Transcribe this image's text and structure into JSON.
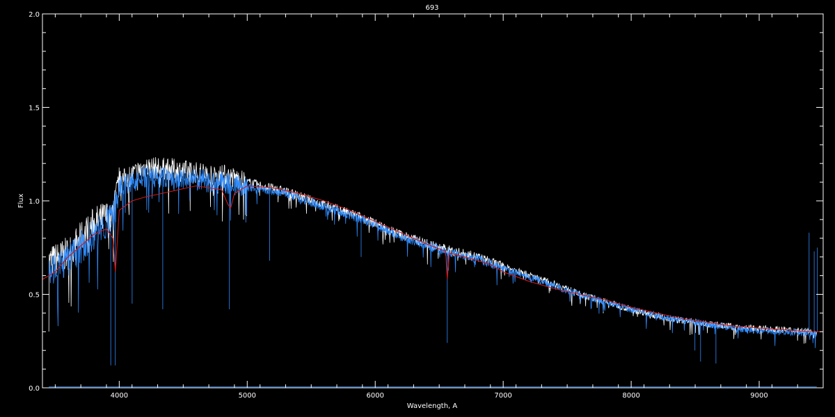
{
  "chart_data": {
    "type": "line",
    "title": "693",
    "xlabel": "Wavelength, A",
    "ylabel": "Flux",
    "xlim": [
      3400,
      9500
    ],
    "ylim": [
      0.0,
      2.0
    ],
    "x_ticks": [
      4000,
      5000,
      6000,
      7000,
      8000,
      9000
    ],
    "x_tick_labels": [
      "4000",
      "5000",
      "6000",
      "7000",
      "8000",
      "9000"
    ],
    "y_ticks": [
      0.0,
      0.5,
      1.0,
      1.5,
      2.0
    ],
    "y_tick_labels": [
      "0.0",
      "0.5",
      "1.0",
      "1.5",
      "2.0"
    ],
    "grid": false,
    "background": "#000000",
    "series": [
      {
        "color": "#ffffff",
        "style": "noisy-spectrum",
        "x": [
          3450,
          3600,
          3800,
          3950,
          4000,
          4200,
          4400,
          4600,
          4800,
          5000,
          5300,
          5600,
          5900,
          6200,
          6500,
          6800,
          7000,
          7300,
          7500,
          7600,
          7700,
          8000,
          8300,
          8600,
          8900,
          9200,
          9450
        ],
        "y": [
          0.67,
          0.72,
          0.88,
          0.93,
          1.1,
          1.18,
          1.17,
          1.15,
          1.14,
          1.1,
          1.05,
          0.98,
          0.91,
          0.82,
          0.75,
          0.7,
          0.65,
          0.58,
          0.53,
          0.5,
          0.48,
          0.42,
          0.37,
          0.34,
          0.32,
          0.31,
          0.3
        ]
      },
      {
        "color": "#2f8cff",
        "style": "noisy-spectrum",
        "x": [
          3450,
          3600,
          3800,
          3950,
          4000,
          4200,
          4400,
          4600,
          4800,
          5000,
          5300,
          5600,
          5900,
          6200,
          6500,
          6800,
          7000,
          7300,
          7500,
          7600,
          7700,
          8000,
          8300,
          8600,
          8900,
          9200,
          9450
        ],
        "y": [
          0.63,
          0.68,
          0.82,
          0.9,
          1.07,
          1.13,
          1.12,
          1.11,
          1.1,
          1.07,
          1.04,
          0.97,
          0.9,
          0.81,
          0.74,
          0.69,
          0.64,
          0.57,
          0.52,
          0.5,
          0.48,
          0.42,
          0.37,
          0.34,
          0.31,
          0.3,
          0.29
        ]
      },
      {
        "color": "#cc1a1a",
        "style": "smooth",
        "x": [
          3400,
          3500,
          3600,
          3700,
          3800,
          3900,
          3950,
          3970,
          4000,
          4100,
          4200,
          4400,
          4600,
          4800,
          4850,
          4870,
          4900,
          5000,
          5200,
          5400,
          5600,
          5800,
          6000,
          6200,
          6400,
          6550,
          6563,
          6580,
          6700,
          6900,
          7000,
          7200,
          7400,
          7600,
          7800,
          8000,
          8200,
          8400,
          8600,
          8800,
          9000,
          9200,
          9400,
          9500
        ],
        "y": [
          0.58,
          0.62,
          0.7,
          0.76,
          0.82,
          0.85,
          0.8,
          0.62,
          0.95,
          1.0,
          1.02,
          1.05,
          1.08,
          1.06,
          0.98,
          0.96,
          1.04,
          1.08,
          1.07,
          1.04,
          1.0,
          0.95,
          0.89,
          0.83,
          0.77,
          0.73,
          0.58,
          0.72,
          0.7,
          0.66,
          0.62,
          0.57,
          0.53,
          0.5,
          0.47,
          0.43,
          0.4,
          0.37,
          0.35,
          0.33,
          0.32,
          0.31,
          0.3,
          0.3
        ]
      },
      {
        "color": "#2f8cff",
        "style": "baseline",
        "x": [
          3450,
          9450
        ],
        "y": [
          0.005,
          0.005
        ]
      }
    ],
    "absorption_lines": [
      {
        "x": 3934,
        "depth_to": 0.12
      },
      {
        "x": 3969,
        "depth_to": 0.12
      },
      {
        "x": 4101,
        "depth_to": 0.45
      },
      {
        "x": 4340,
        "depth_to": 0.42
      },
      {
        "x": 4861,
        "depth_to": 0.42
      },
      {
        "x": 5175,
        "depth_to": 0.68
      },
      {
        "x": 5890,
        "depth_to": 0.7
      },
      {
        "x": 6563,
        "depth_to": 0.24
      },
      {
        "x": 8498,
        "depth_to": 0.2
      },
      {
        "x": 8542,
        "depth_to": 0.14
      },
      {
        "x": 8662,
        "depth_to": 0.13
      }
    ],
    "emission_spikes": [
      {
        "x": 9390,
        "peak": 0.83
      },
      {
        "x": 9430,
        "peak": 0.73
      },
      {
        "x": 9455,
        "peak": 0.75
      }
    ]
  }
}
